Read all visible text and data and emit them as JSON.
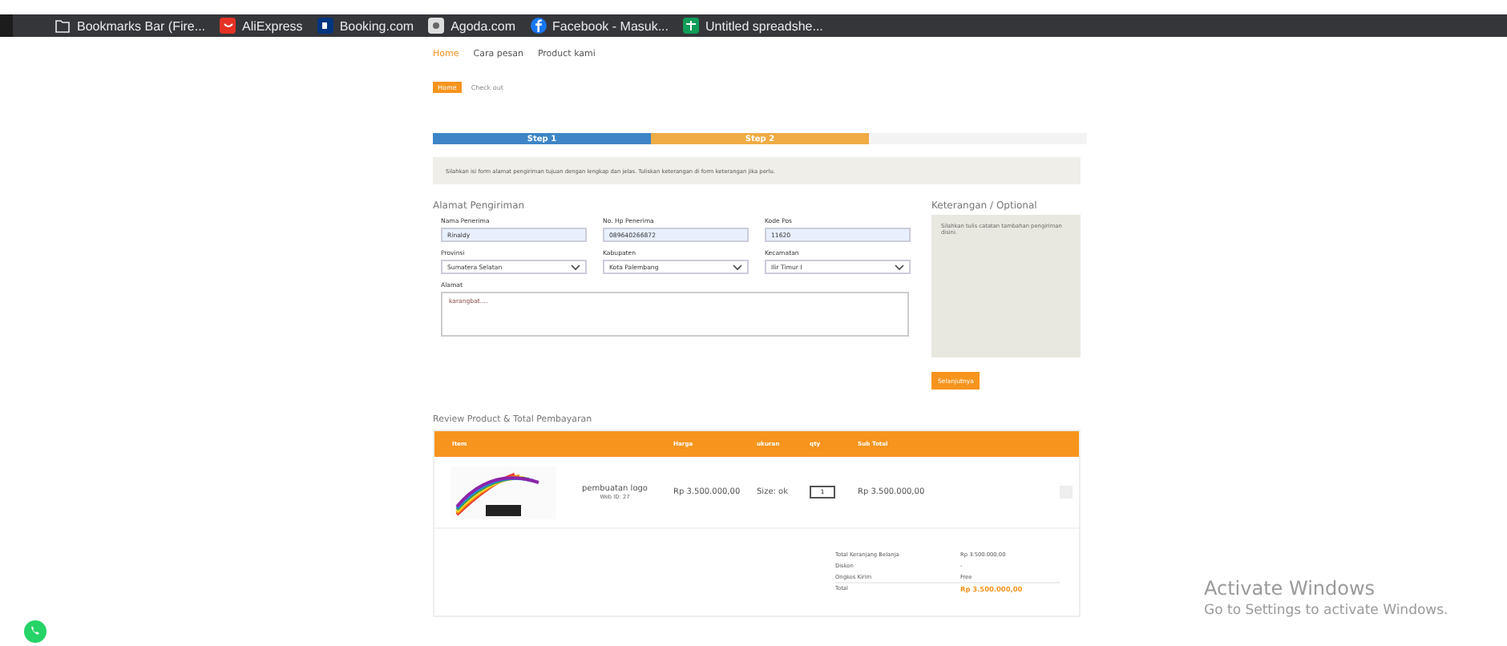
{
  "bookmarks_bar": {
    "items": [
      {
        "kind": "folder",
        "label": "Bookmarks Bar (Fire..."
      },
      {
        "kind": "aliexpress",
        "label": "AliExpress"
      },
      {
        "kind": "booking",
        "label": "Booking.com"
      },
      {
        "kind": "agoda",
        "label": "Agoda.com"
      },
      {
        "kind": "facebook",
        "label": "Facebook - Masuk..."
      },
      {
        "kind": "sheets",
        "label": "Untitled spreadshe..."
      }
    ]
  },
  "nav": [
    {
      "label": "Home",
      "selected": true
    },
    {
      "label": "Cara pesan",
      "selected": false
    },
    {
      "label": "Product kami",
      "selected": false
    }
  ],
  "breadcrumb": [
    "Home",
    "Check out"
  ],
  "steps": [
    {
      "label": "Step 1",
      "color": "#3d85c6"
    },
    {
      "label": "Step 2",
      "color": "#f0ab45"
    }
  ],
  "info": "Silahkan isi form alamat pengiriman tujuan dengan lengkap dan jelas. Tuliskan keterangan di form keterangan jika perlu.",
  "shipping": {
    "title": "Alamat Pengiriman",
    "fields": [
      {
        "kind": "input",
        "label": "Nama Penerima",
        "value": "Rinaldy"
      },
      {
        "kind": "input",
        "label": "No. Hp Penerima",
        "value": "089640266872"
      },
      {
        "kind": "input",
        "label": "Kode Pos",
        "value": "11620"
      },
      {
        "kind": "select",
        "label": "Provinsi",
        "value": "Sumatera Selatan"
      },
      {
        "kind": "select",
        "label": "Kabupaten",
        "value": "Kota Palembang"
      },
      {
        "kind": "select",
        "label": "Kecamatan",
        "value": "Ilir Timur I"
      }
    ],
    "address": {
      "label": "Alamat",
      "value": "karangbat...."
    }
  },
  "notes": {
    "title": "Keterangan / Optional",
    "placeholder": "Silahkan tulis catatan tambahan pengiriman disini."
  },
  "next_button": "Selanjutnya",
  "review": {
    "title": "Review Product & Total Pembayaran",
    "columns": [
      "Item",
      "Harga",
      "ukuran",
      "qty",
      "Sub Total"
    ],
    "rows": [
      {
        "name": "pembuatan logo",
        "web_id": "Web ID: 27",
        "price": "Rp 3.500.000,00",
        "size": "Size: ok",
        "qty": "1",
        "subtotal": "Rp 3.500.000,00"
      }
    ],
    "totals": [
      {
        "label": "Total Keranjang Belanja",
        "value": "Rp 3.500.000,00",
        "highlight": false
      },
      {
        "label": "Diskon",
        "value": "-",
        "highlight": false
      },
      {
        "label": "Ongkos Kirim",
        "value": "Free",
        "highlight": false
      },
      {
        "label": "Total",
        "value": "Rp 3.500.000,00",
        "highlight": true
      }
    ]
  },
  "os_notice": {
    "title": "Activate Windows",
    "subtitle": "Go to Settings to activate Windows."
  }
}
